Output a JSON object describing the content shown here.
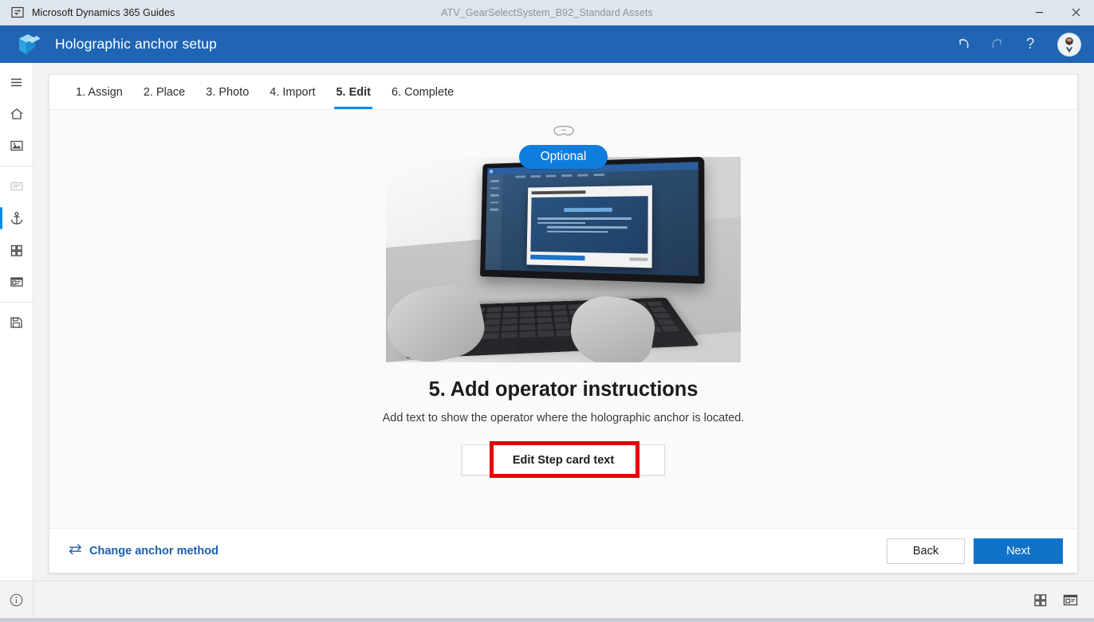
{
  "window": {
    "app_icon": "dynamics-guides-app-icon",
    "app_title": "Microsoft Dynamics 365 Guides",
    "document_title": "ATV_GearSelectSystem_B92_Standard Assets",
    "minimize_label": "–",
    "close_label": "✕"
  },
  "header": {
    "logo": "dynamics-365-guides-logo",
    "title": "Holographic anchor setup",
    "actions": [
      {
        "name": "undo-icon",
        "label": "Undo",
        "enabled": true
      },
      {
        "name": "redo-icon",
        "label": "Redo",
        "enabled": false
      },
      {
        "name": "help-icon",
        "label": "?",
        "enabled": true
      }
    ],
    "avatar": "user-avatar"
  },
  "rail": {
    "items": [
      {
        "name": "menu-icon",
        "label": "Menu",
        "state": "normal"
      },
      {
        "name": "home-icon",
        "label": "Home",
        "state": "normal"
      },
      {
        "name": "media-icon",
        "label": "Media",
        "state": "normal"
      },
      {
        "name": "outline-icon",
        "label": "Outline",
        "state": "muted"
      },
      {
        "name": "anchor-icon",
        "label": "Anchor",
        "state": "active"
      },
      {
        "name": "steps-grid-icon",
        "label": "Steps",
        "state": "normal"
      },
      {
        "name": "step-card-icon",
        "label": "Step card",
        "state": "normal"
      },
      {
        "name": "save-icon",
        "label": "Save",
        "state": "normal"
      }
    ]
  },
  "tabs": [
    {
      "label": "1. Assign",
      "active": false
    },
    {
      "label": "2. Place",
      "active": false
    },
    {
      "label": "3. Photo",
      "active": false
    },
    {
      "label": "4. Import",
      "active": false
    },
    {
      "label": "5. Edit",
      "active": true
    },
    {
      "label": "6. Complete",
      "active": false
    }
  ],
  "content": {
    "headset_icon": "hololens-headset-icon",
    "badge": "Optional",
    "illustration": "photo-hands-typing-on-laptop-editing-anchoring-instructions",
    "step_title": "5. Add operator instructions",
    "step_description": "Add text to show the operator where the holographic anchor is located.",
    "edit_button": "Edit Step card text",
    "highlight_color": "#e50000"
  },
  "footer": {
    "change_anchor_icon": "swap-arrows-icon",
    "change_anchor_label": "Change anchor method",
    "back_label": "Back",
    "next_label": "Next"
  },
  "statusbar": {
    "info_icon": "info-circle-icon",
    "grid_view_icon": "grid-view-icon",
    "card_view_icon": "card-view-icon"
  },
  "colors": {
    "header_blue": "#2065b3",
    "accent_blue": "#0f8ce8",
    "primary_button": "#1071c9",
    "badge_blue": "#0f7ddb",
    "link_blue": "#1b5fae",
    "annotation_red": "#e50000"
  }
}
